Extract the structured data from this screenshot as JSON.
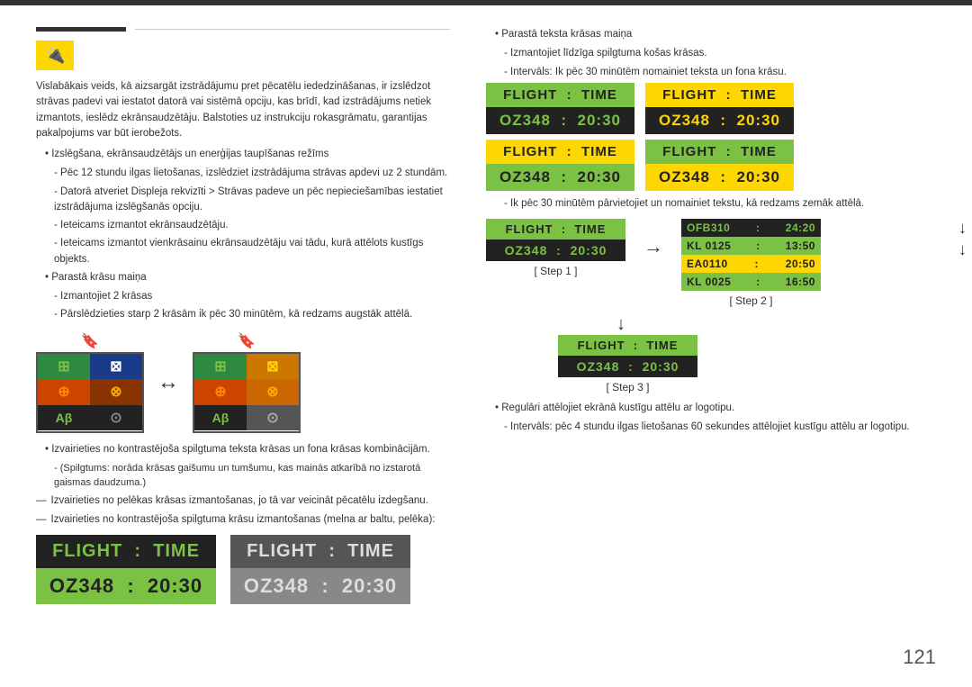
{
  "page": {
    "number": "121",
    "topbar_color": "#333"
  },
  "left": {
    "section_icon": "🔌",
    "intro_text": "Vislabākais veids, kā aizsargāt izstrādājumu pret pēcatēlu iededzināšanas, ir izslēdzot strāvas padevi vai iestatot datorā vai sistēmā opciju, kas brīdī, kad izstrādājums netiek izmantots, ieslēdz ekrānsaudzētāju. Balstoties uz instrukciju rokasgrāmatu, garantijas pakalpojums var būt ierobežots.",
    "bullet1": "Izslēgšana, ekrānsaudzētājs un enerģijas taupīšanas režīms",
    "dash1": "Pēc 12 stundu ilgas lietošanas, izslēdziet izstrādājuma strāvas apdevi uz 2 stundām.",
    "dash2": "Datorā atveriet Displeja rekvizīti > Strāvas padeve un pēc nepieciešamības iestatiet izstrādājuma izslēgšanās opciju.",
    "dash3": "Ieteicams izmantot ekrānsaudzētāju.",
    "dash4": "Ieteicams izmantot vienkrāsainu ekrānsaudzētāju vai tādu, kurā attēlots kustīgs objekts.",
    "bullet2": "Parastā krāsu maiņa",
    "dash5": "Izmantojiet 2 krāsas",
    "dash6": "Pārslēdzieties starp 2 krāsām ik pēc 30 minūtēm, kā redzams augstāk attēlā.",
    "bullet3": "Izvairieties no kontrastējoša spilgtuma teksta krāsas un fona krāsas kombinācijām.",
    "paren1": "(Spilgtums: norāda krāsas gaišumu un tumšumu, kas mainās atkarībā no izstarotā gaismas daudzuma.)",
    "emdash1": "Izvairieties no pelēkas krāsas izmantošanas, jo tā var veicināt pēcatēlu izdegšanu.",
    "emdash2": "Izvairieties no kontrastējoša spilgtuma krāsu izmantošanas (melna ar baltu, pelēka):",
    "large_widget1": {
      "header": "FLIGHT   :   TIME",
      "body": "OZ348   :   20:30",
      "header_bg": "#222",
      "header_color": "#7bc143",
      "body_bg": "#7bc143",
      "body_color": "#222"
    },
    "large_widget2": {
      "header": "FLIGHT   :   TIME",
      "body": "OZ348   :   20:30",
      "header_bg": "#555",
      "header_color": "#fff",
      "body_bg": "#888",
      "body_color": "#fff"
    }
  },
  "right": {
    "bullet1": "Parastā teksta krāsas maiņa",
    "dash1": "Izmantojiet līdzīga spilgtuma košas krāsas.",
    "dash2": "Intervāls: Ik pēc 30 minūtēm nomainiet teksta un fona krāsu.",
    "widgets_row1": [
      {
        "header": "FLIGHT   :   TIME",
        "body": "OZ348   :   20:30",
        "hbg": "#7bc143",
        "hc": "#222",
        "bbg": "#222",
        "bc": "#7bc143"
      },
      {
        "header": "FLIGHT   :   TIME",
        "body": "OZ348   :   20:30",
        "hbg": "#FFD700",
        "hc": "#222",
        "bbg": "#222",
        "bc": "#FFD700"
      }
    ],
    "widgets_row2": [
      {
        "header": "FLIGHT   :   TIME",
        "body": "OZ348   :   20:30",
        "hbg": "#FFD700",
        "hc": "#222",
        "bbg": "#7bc143",
        "bc": "#222"
      },
      {
        "header": "FLIGHT   :   TIME",
        "body": "OZ348   :   20:30",
        "hbg": "#7bc143",
        "hc": "#222",
        "bbg": "#FFD700",
        "bc": "#222"
      }
    ],
    "step_desc": "Ik pēc 30 minūtēm pārvietojiet un nomainiet tekstu, kā redzams zemāk attēlā.",
    "step1": {
      "label": "[ Step 1 ]",
      "header": "FLIGHT   :   TIME",
      "body": "OZ348   :   20:30",
      "hbg": "#7bc143",
      "hc": "#222",
      "bbg": "#222",
      "bc": "#7bc143"
    },
    "step2": {
      "label": "[ Step 2 ]",
      "rows": [
        {
          "text": "OFB310 : 24:20",
          "bg": "#222",
          "color": "#7bc143"
        },
        {
          "text": "KL 0125 : 13:50",
          "bg": "#7bc143",
          "color": "#222"
        },
        {
          "text": "EA0110 : 20:50",
          "bg": "#FFD700",
          "color": "#222"
        },
        {
          "text": "KL 0025 : 16:50",
          "bg": "#7bc143",
          "color": "#222"
        }
      ]
    },
    "step3": {
      "label": "[ Step 3 ]",
      "header": "FLIGHT   :   TIME",
      "body": "OZ348   :   20:30",
      "hbg": "#7bc143",
      "hc": "#222",
      "bbg": "#222",
      "bc": "#7bc143"
    },
    "bullet2": "Regulāri attēlojiet ekrānā kustīgu attēlu ar logotipu.",
    "dash3": "Intervāls: pēc 4 stundu ilgas lietošanas 60 sekundes attēlojiet kustīgu attēlu ar logotipu."
  },
  "grid1": {
    "cells": [
      {
        "bg": "#2d8a3e",
        "color": "#7bc143",
        "symbol": "⊞"
      },
      {
        "bg": "#1a3a8a",
        "color": "#fff",
        "symbol": "⊠"
      },
      {
        "bg": "#cc4400",
        "color": "#ff8800",
        "symbol": "⊕"
      },
      {
        "bg": "#883300",
        "color": "#ffaa00",
        "symbol": "⊗"
      },
      {
        "bg": "#222",
        "color": "#7bc143",
        "symbol": "Aβ"
      },
      {
        "bg": "#222",
        "color": "#888",
        "symbol": "⊙"
      }
    ]
  },
  "grid2": {
    "cells": [
      {
        "bg": "#2d8a3e",
        "color": "#7bc143",
        "symbol": "⊞"
      },
      {
        "bg": "#cc7700",
        "color": "#FFD700",
        "symbol": "⊠"
      },
      {
        "bg": "#cc4400",
        "color": "#ff8800",
        "symbol": "⊕"
      },
      {
        "bg": "#cc6600",
        "color": "#ffaa00",
        "symbol": "⊗"
      },
      {
        "bg": "#222",
        "color": "#7bc143",
        "symbol": "Aβ"
      },
      {
        "bg": "#555",
        "color": "#aaa",
        "symbol": "⊙"
      }
    ]
  },
  "icons": {
    "swap_arrow": "↔",
    "down_arrow": "↓",
    "right_arrow": "→",
    "bookmark": "🔖"
  }
}
